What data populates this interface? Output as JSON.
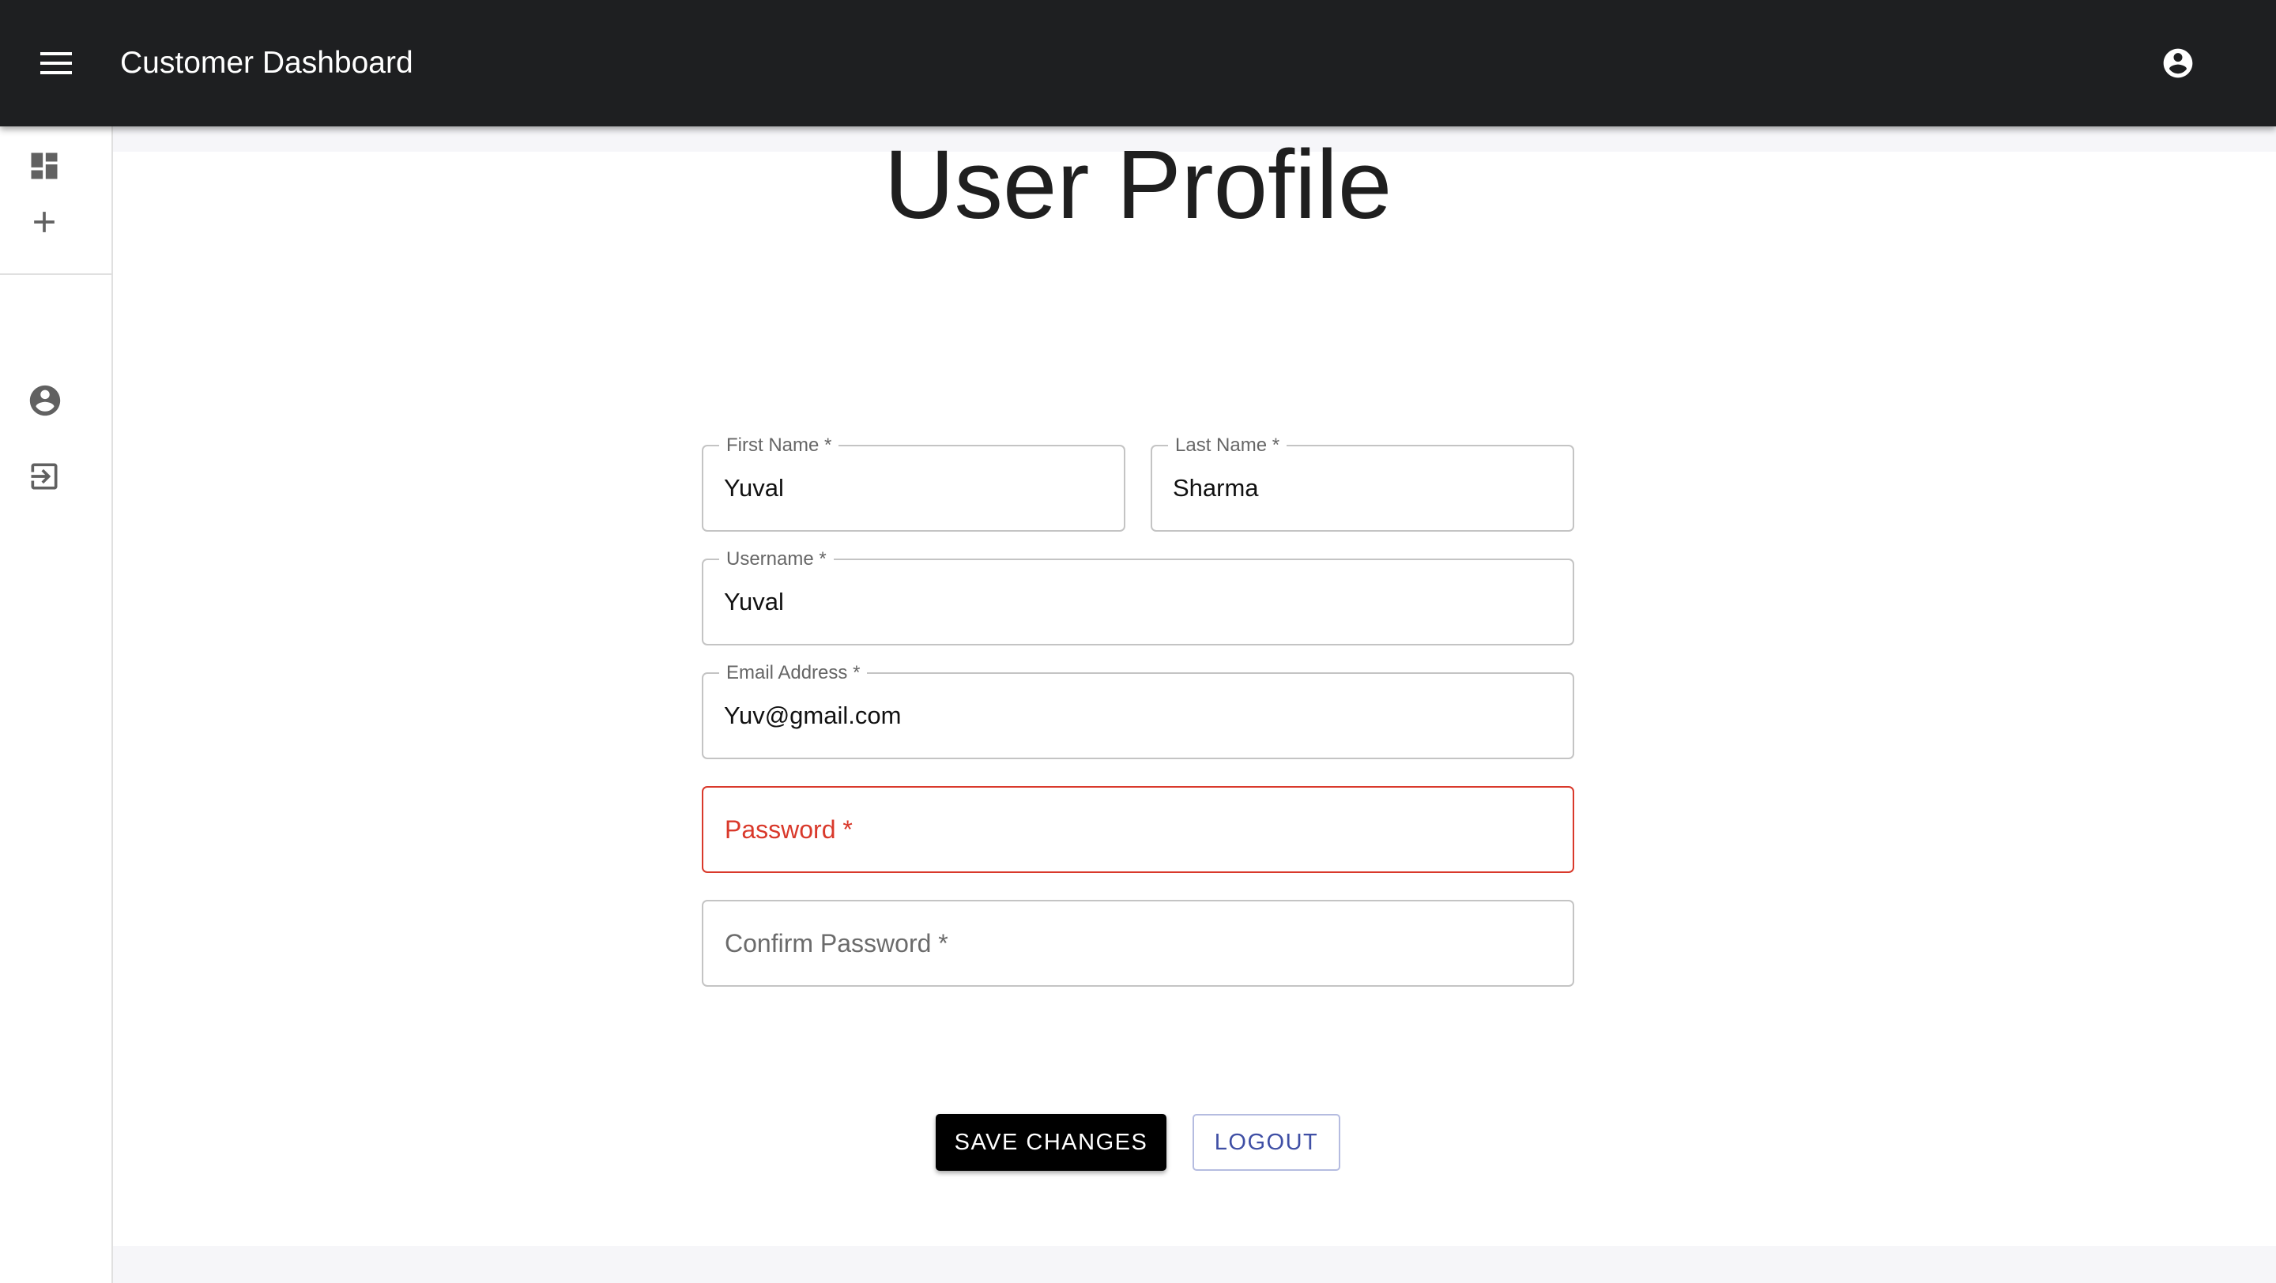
{
  "appbar": {
    "title": "Customer Dashboard",
    "menu_icon": "menu-icon",
    "account_icon": "account-circle-icon"
  },
  "drawer": {
    "items": [
      {
        "icon": "dashboard-icon"
      },
      {
        "icon": "add-icon"
      },
      {
        "icon": "account-circle-icon"
      },
      {
        "icon": "logout-icon"
      }
    ]
  },
  "profile": {
    "title": "User Profile",
    "fields": {
      "first_name": {
        "label": "First Name *",
        "value": "Yuval"
      },
      "last_name": {
        "label": "Last Name *",
        "value": "Sharma"
      },
      "username": {
        "label": "Username *",
        "value": "Yuval"
      },
      "email": {
        "label": "Email Address *",
        "value": "Yuv@gmail.com"
      },
      "password": {
        "placeholder": "Password *",
        "state": "error"
      },
      "confirm_password": {
        "placeholder": "Confirm Password *"
      }
    },
    "buttons": {
      "save": "SAVE CHANGES",
      "logout": "LOGOUT"
    }
  },
  "colors": {
    "appbar": "#1e1f21",
    "error": "#d9392b",
    "primary_outline": "#3f4fa5",
    "save_button": "#000000"
  }
}
